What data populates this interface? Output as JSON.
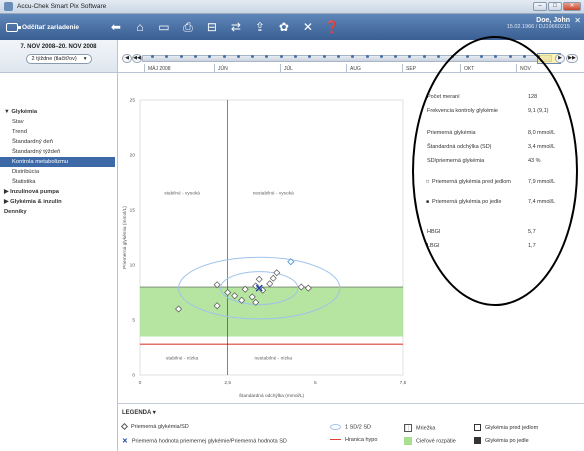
{
  "app": {
    "title": "Accu-Chek Smart Pix Software"
  },
  "toolbar": {
    "read_label": "Odčítať zariadenie",
    "tools": [
      "arrow-left-icon",
      "home-icon",
      "document-icon",
      "print-icon",
      "export-icon",
      "transfer-icon",
      "upload-icon",
      "settings-icon",
      "tools-icon",
      "help-icon"
    ],
    "tool_glyphs": [
      "⬅",
      "⌂",
      "▭",
      "⎙",
      "⊟",
      "⇄",
      "⇪",
      "✿",
      "✕",
      "❓"
    ]
  },
  "user": {
    "name": "Doe, John",
    "id": "15.02.1966 / DJ19660215"
  },
  "range": {
    "text": "7. NOV 2008–20. NOV 2008",
    "select": "2 týždne (tlačiť/ov)"
  },
  "nav": [
    {
      "label": "Glykémia",
      "group": true
    },
    {
      "label": "Stav"
    },
    {
      "label": "Trend"
    },
    {
      "label": "Štandardný deň"
    },
    {
      "label": "Štandardný týždeň"
    },
    {
      "label": "Kontrola metabolizmu",
      "active": true
    },
    {
      "label": "Distribúcia"
    },
    {
      "label": "Štatistika"
    },
    {
      "label": "Inzulínová pumpa",
      "group": true
    },
    {
      "label": "Glykémia & inzulín",
      "group": true
    },
    {
      "label": "Denníky",
      "group": true,
      "noarrow": true
    }
  ],
  "timeline": {
    "months": [
      "MÁJ 2008",
      "JÚN",
      "JÚL",
      "AUG",
      "SEP",
      "OKT",
      "NOV"
    ]
  },
  "chart_data": {
    "type": "scatter",
    "xlabel": "Štandardná odchýlka (mmol/L)",
    "ylabel": "Priemerná glykémia (mmol/L)",
    "xlim": [
      0,
      7.5
    ],
    "ylim": [
      0,
      25
    ],
    "xticks": [
      "0",
      "2,5",
      "5",
      "7,5"
    ],
    "yticks": [
      "0",
      "5",
      "10",
      "15",
      "20",
      "25"
    ],
    "quadrants": [
      "stabilné - vysoká",
      "nestabilné - vysoká",
      "stabilné - nízka",
      "nestabilné - nízka"
    ],
    "target_range": [
      3.5,
      8.0
    ],
    "hypo_limit": 2.8,
    "points_pre_meal": [
      [
        1.1,
        6.0
      ],
      [
        2.2,
        6.3
      ],
      [
        2.2,
        8.2
      ],
      [
        2.5,
        7.5
      ],
      [
        2.7,
        7.2
      ],
      [
        2.9,
        6.8
      ],
      [
        3.0,
        7.8
      ],
      [
        3.2,
        7.1
      ],
      [
        3.3,
        6.6
      ],
      [
        3.3,
        8.1
      ],
      [
        3.4,
        8.7
      ],
      [
        3.5,
        7.7
      ],
      [
        3.7,
        8.3
      ],
      [
        3.8,
        8.8
      ],
      [
        3.9,
        9.3
      ],
      [
        4.6,
        8.0
      ],
      [
        4.8,
        7.9
      ]
    ],
    "points_post_meal": [
      [
        4.3,
        10.3
      ]
    ],
    "mean_point": [
      3.4,
      7.9
    ],
    "sd_ellipse": {
      "center": [
        3.4,
        7.9
      ],
      "rx1": 1.1,
      "ry1": 1.5,
      "rx2": 2.3,
      "ry2": 2.8
    }
  },
  "stats": [
    {
      "label": "Počet meraní",
      "value": "128"
    },
    {
      "label": "Frekvencia kontroly glykémie",
      "value": "9,1 (9,1)"
    },
    {
      "label": "Priemerná glykémia",
      "value": "8,0 mmol/L"
    },
    {
      "label": "Štandardná odchýlka (SD)",
      "value": "3,4 mmol/L"
    },
    {
      "label": "SD/priemerná glykémia",
      "value": "43 %"
    },
    {
      "label": "Priemerná glykémia pred jedlom",
      "value": "7,9 mmol/L"
    },
    {
      "label": "Priemerná glykémia po jedle",
      "value": "7,4 mmol/L"
    },
    {
      "label": "HBGI",
      "value": "5,7"
    },
    {
      "label": "LBGI",
      "value": "1,7"
    }
  ],
  "legend": {
    "title": "LEGENDA",
    "items": [
      "Priemerná glykémia/SD",
      "Priemerná hodnota priemernej glykémie/Priemerná hodnota SD",
      "1 SD/2 SD",
      "Hranica hypo",
      "Mriežka",
      "Cieľové rozpätie",
      "Glykémia pred jedlom",
      "Glykémia po jedle"
    ]
  },
  "colors": {
    "target": "#a8e08f",
    "hypo": "#e0403a",
    "ellipse": "#9ec3ea",
    "post_meal": "#4a90d9",
    "mean": "#1a3fa8"
  }
}
